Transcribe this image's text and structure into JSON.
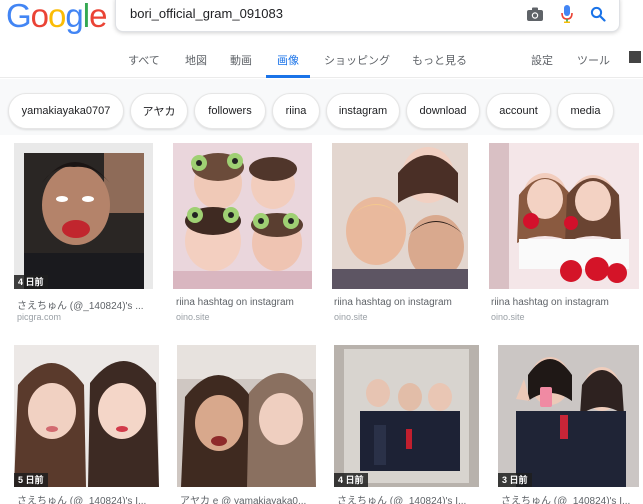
{
  "logo": {
    "letters": [
      "G",
      "o",
      "o",
      "g",
      "l",
      "e"
    ],
    "colors": [
      "#4285F4",
      "#EA4335",
      "#FBBC05",
      "#4285F4",
      "#34A853",
      "#EA4335"
    ]
  },
  "search": {
    "query": "bori_official_gram_091083",
    "camera_icon": "camera-icon",
    "mic_icon": "mic-icon",
    "search_icon": "search-icon"
  },
  "tabs": {
    "items": [
      "すべて",
      "地図",
      "動画",
      "画像",
      "ショッピング",
      "もっと見る"
    ],
    "active": "画像",
    "settings": "設定",
    "tools": "ツール"
  },
  "chips": [
    "yamakiayaka0707",
    "アヤカ",
    "followers",
    "riina",
    "instagram",
    "download",
    "account",
    "media"
  ],
  "results": [
    {
      "title": "さえちゅん (@_140824)'s ...",
      "source": "picgra.com",
      "badge": "4 日前"
    },
    {
      "title": "riina hashtag on instagram",
      "source": "oino.site",
      "badge": ""
    },
    {
      "title": "riina hashtag on instagram",
      "source": "oino.site",
      "badge": ""
    },
    {
      "title": "riina hashtag on instagram",
      "source": "oino.site",
      "badge": ""
    },
    {
      "title": "さえちゅん (@_140824)'s I...",
      "source": "",
      "badge": "5 日前"
    },
    {
      "title": "アヤカ e @ yamakiayaka0...",
      "source": "",
      "badge": ""
    },
    {
      "title": "さえちゅん (@_140824)'s I...",
      "source": "",
      "badge": "4 日前"
    },
    {
      "title": "さえちゅん (@_140824)'s I...",
      "source": "",
      "badge": "3 日前"
    }
  ],
  "colors": {
    "accent": "#1a73e8",
    "chip_bar_bg": "#f8f9fa",
    "badge_bg": "#1e1e1e"
  }
}
